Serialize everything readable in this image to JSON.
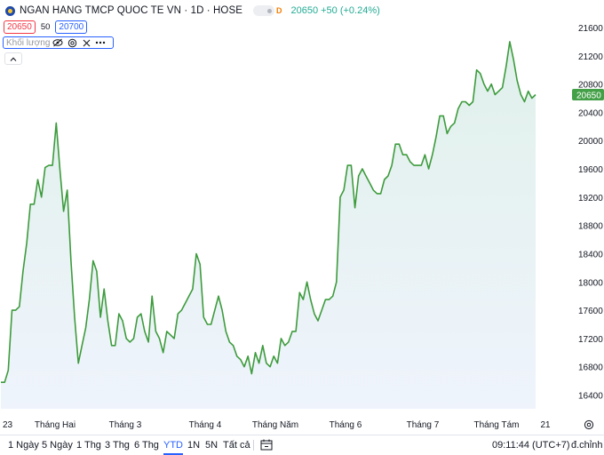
{
  "header": {
    "title": "NGAN HANG TMCP QUOC TE VN · 1D · HOSE",
    "market_badge": "D",
    "change": "20650 +50 (+0.24%)"
  },
  "quote": {
    "bid": "20650",
    "spread": "50",
    "ask": "20700"
  },
  "volume_indicator": {
    "label": "Khối lượng"
  },
  "bottom_bar": {
    "ranges": [
      "1 Ngày",
      "5 Ngày",
      "1 Thg",
      "3 Thg",
      "6 Thg",
      "YTD",
      "1N",
      "5N",
      "Tất cả"
    ],
    "active_range": "YTD",
    "clock": "09:11:44 (UTC+7)",
    "adjust": "đ.chỉnh"
  },
  "colors": {
    "line": "#3d9b3d",
    "fill_top": "#dff0ea",
    "fill_bottom": "#eef3fc",
    "price_badge": "#43a047"
  },
  "chart_data": {
    "type": "area",
    "x_ticks": [
      "23",
      "Tháng Hai",
      "Tháng 3",
      "Tháng 4",
      "Tháng Năm",
      "Tháng 6",
      "Tháng 7",
      "Tháng Tám",
      "21"
    ],
    "y_ticks": [
      16400,
      16800,
      17200,
      17600,
      18000,
      18400,
      18800,
      19200,
      19600,
      20000,
      20400,
      20800,
      21200,
      21600
    ],
    "ylim": [
      16150,
      21700
    ],
    "last_price": 20650,
    "grid": false,
    "series": [
      {
        "values": [
          16580,
          16580,
          16750,
          17600,
          17600,
          17650,
          18150,
          18550,
          19100,
          19100,
          19450,
          19200,
          19620,
          19650,
          19650,
          20250,
          19600,
          19000,
          19300,
          18300,
          17500,
          16850,
          17100,
          17350,
          17750,
          18300,
          18150,
          17500,
          17900,
          17450,
          17100,
          17100,
          17550,
          17450,
          17200,
          17150,
          17200,
          17500,
          17550,
          17300,
          17150,
          17800,
          17300,
          17200,
          17000,
          17300,
          17250,
          17200,
          17550,
          17600,
          17700,
          17800,
          17900,
          18400,
          18250,
          17500,
          17400,
          17400,
          17600,
          17800,
          17600,
          17300,
          17150,
          17100,
          16950,
          16900,
          16800,
          16950,
          16700,
          17000,
          16850,
          17100,
          16850,
          16800,
          16950,
          16850,
          17200,
          17100,
          17150,
          17300,
          17300,
          17850,
          17750,
          18000,
          17750,
          17550,
          17450,
          17600,
          17750,
          17750,
          17800,
          18000,
          19200,
          19300,
          19650,
          19650,
          19050,
          19500,
          19600,
          19500,
          19400,
          19300,
          19250,
          19250,
          19450,
          19500,
          19650,
          19950,
          19950,
          19800,
          19800,
          19700,
          19650,
          19650,
          19650,
          19800,
          19600,
          19800,
          20050,
          20350,
          20350,
          20100,
          20200,
          20250,
          20450,
          20550,
          20550,
          20500,
          20550,
          21000,
          20950,
          20800,
          20700,
          20800,
          20650,
          20700,
          20750,
          21050,
          21400,
          21150,
          20850,
          20650,
          20550,
          20700,
          20600,
          20650
        ]
      }
    ]
  }
}
